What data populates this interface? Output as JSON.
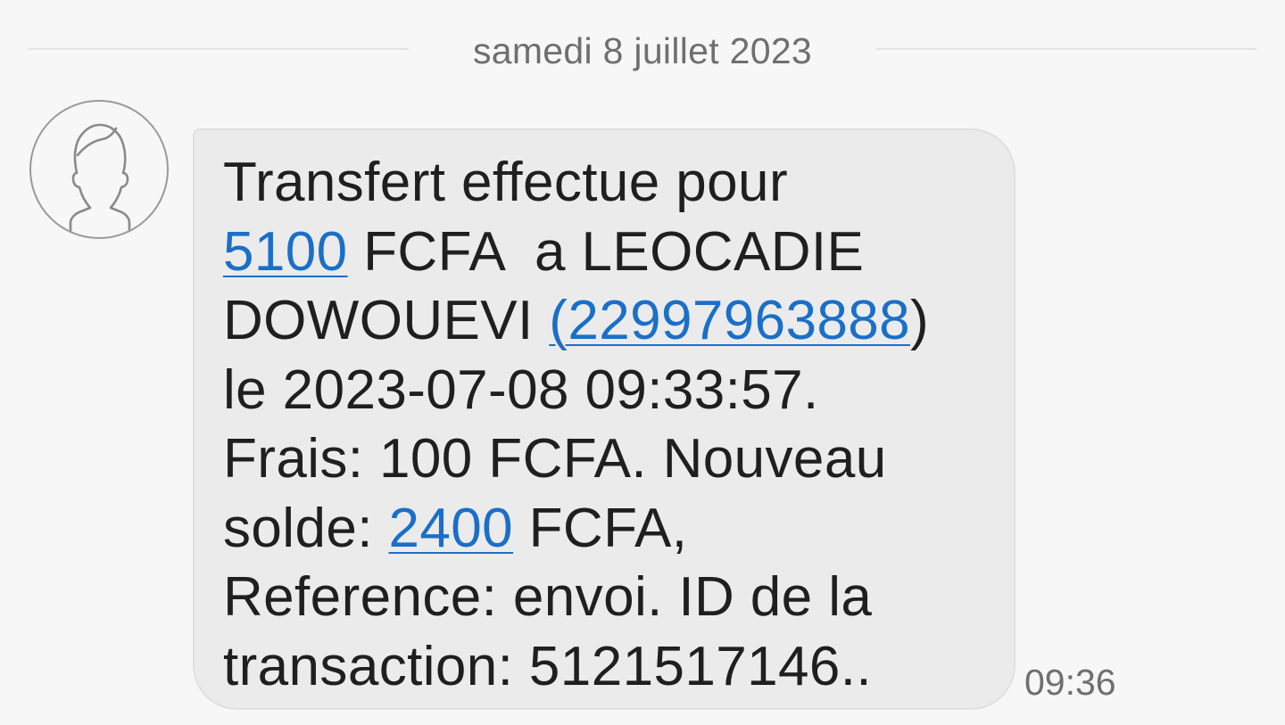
{
  "conversation": {
    "date_separator": "samedi 8 juillet 2023"
  },
  "message": {
    "line1": "Transfert effectue pour",
    "line2_amount_link": "5100",
    "line2_rest": " FCFA  a LEOCADIE",
    "line3_prefix": "DOWOUEVI ",
    "line3_phone_link": "(22997963888",
    "line3_suffix": ")",
    "line4": "le 2023-07-08 09:33:57.",
    "line5": "Frais: 100 FCFA. Nouveau",
    "line6_prefix": "solde: ",
    "line6_balance_link": "2400",
    "line6_suffix": " FCFA,",
    "line7": "Reference: envoi. ID de la",
    "line8": "transaction: 5121517146..",
    "time": "09:36"
  },
  "colors": {
    "background": "#f7f7f7",
    "bubble": "#ebebeb",
    "link": "#1a6fc8",
    "text": "#1f1f1f",
    "muted": "#6f6f6f"
  },
  "icons": {
    "avatar": "default-contact-avatar-icon"
  }
}
